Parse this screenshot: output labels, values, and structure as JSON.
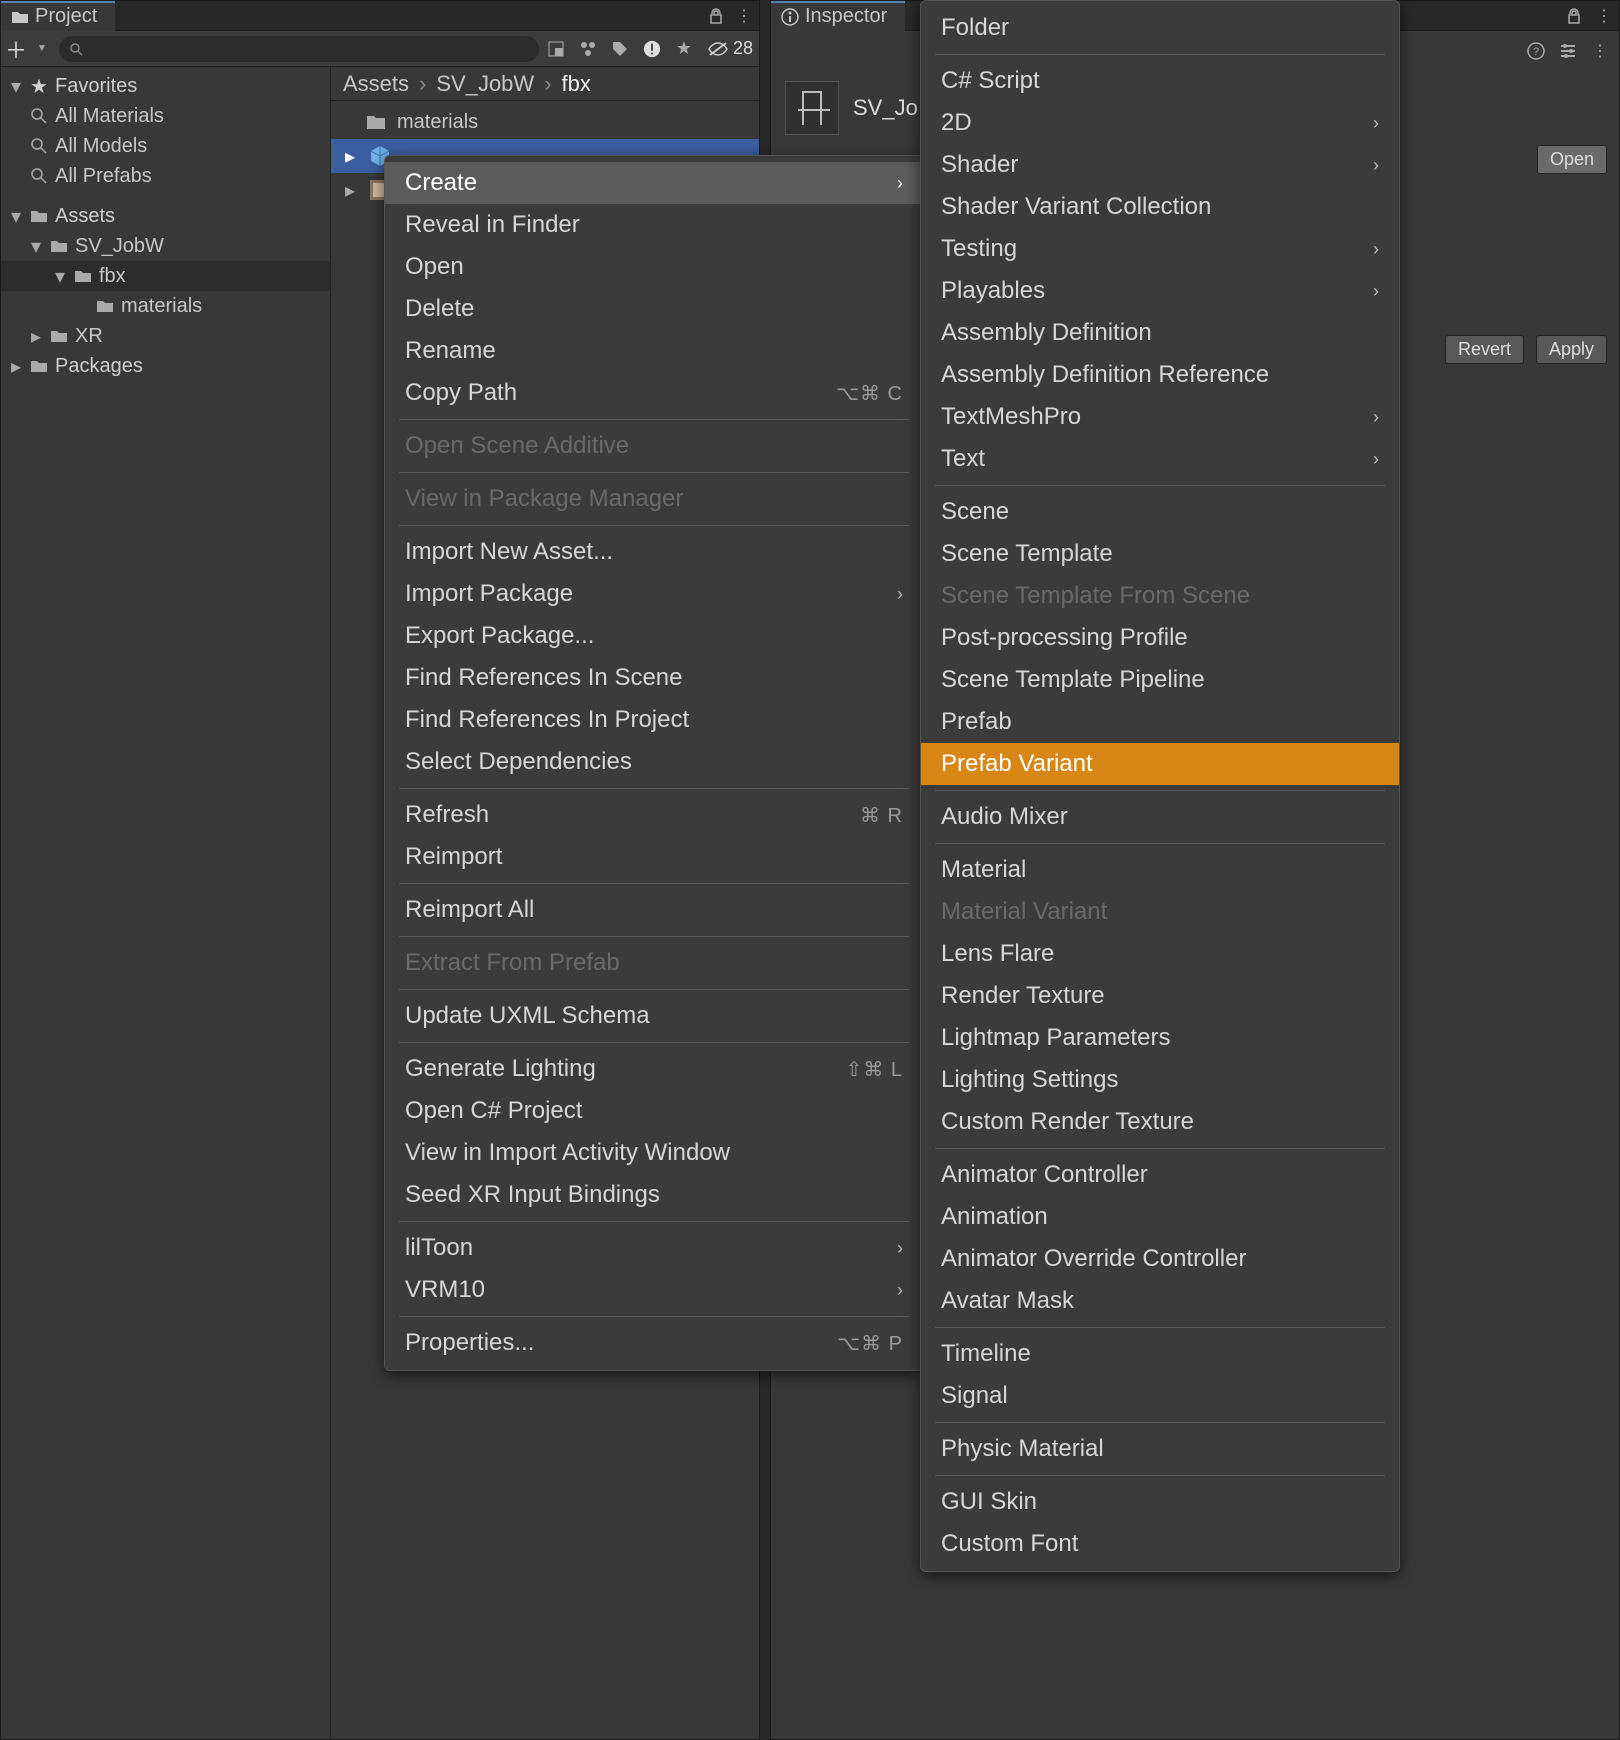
{
  "project": {
    "tab_label": "Project",
    "search_placeholder": "",
    "hidden_count": "28",
    "favorites": {
      "header": "Favorites",
      "items": [
        "All Materials",
        "All Models",
        "All Prefabs"
      ]
    },
    "assets": {
      "header": "Assets",
      "items": [
        {
          "label": "SV_JobW",
          "children": [
            {
              "label": "fbx",
              "children": [
                {
                  "label": "materials"
                }
              ]
            }
          ]
        },
        {
          "label": "XR"
        }
      ],
      "packages": "Packages"
    },
    "breadcrumb": [
      "Assets",
      "SV_JobW",
      "fbx"
    ],
    "files": [
      {
        "label": "materials",
        "kind": "folder"
      },
      {
        "label": "",
        "kind": "prefab-selected"
      },
      {
        "label": "",
        "kind": "image"
      }
    ]
  },
  "inspector": {
    "tab_label": "Inspector",
    "title": "SV_Jo",
    "open_button": "Open",
    "revert_button": "Revert",
    "apply_button": "Apply"
  },
  "context_menu": [
    {
      "label": "Create",
      "submenu": true,
      "highlight": true
    },
    {
      "label": "Reveal in Finder"
    },
    {
      "label": "Open"
    },
    {
      "label": "Delete"
    },
    {
      "label": "Rename"
    },
    {
      "label": "Copy Path",
      "shortcut": "⌥⌘ C"
    },
    {
      "sep": true
    },
    {
      "label": "Open Scene Additive",
      "disabled": true
    },
    {
      "sep": true
    },
    {
      "label": "View in Package Manager",
      "disabled": true
    },
    {
      "sep": true
    },
    {
      "label": "Import New Asset..."
    },
    {
      "label": "Import Package",
      "submenu": true
    },
    {
      "label": "Export Package..."
    },
    {
      "label": "Find References In Scene"
    },
    {
      "label": "Find References In Project"
    },
    {
      "label": "Select Dependencies"
    },
    {
      "sep": true
    },
    {
      "label": "Refresh",
      "shortcut": "⌘ R"
    },
    {
      "label": "Reimport"
    },
    {
      "sep": true
    },
    {
      "label": "Reimport All"
    },
    {
      "sep": true
    },
    {
      "label": "Extract From Prefab",
      "disabled": true
    },
    {
      "sep": true
    },
    {
      "label": "Update UXML Schema"
    },
    {
      "sep": true
    },
    {
      "label": "Generate Lighting",
      "shortcut": "⇧⌘ L"
    },
    {
      "label": "Open C# Project"
    },
    {
      "label": "View in Import Activity Window"
    },
    {
      "label": "Seed XR Input Bindings"
    },
    {
      "sep": true
    },
    {
      "label": "lilToon",
      "submenu": true
    },
    {
      "label": "VRM10",
      "submenu": true
    },
    {
      "sep": true
    },
    {
      "label": "Properties...",
      "shortcut": "⌥⌘ P"
    }
  ],
  "create_menu": [
    {
      "label": "Folder"
    },
    {
      "sep": true
    },
    {
      "label": "C# Script"
    },
    {
      "label": "2D",
      "submenu": true
    },
    {
      "label": "Shader",
      "submenu": true
    },
    {
      "label": "Shader Variant Collection"
    },
    {
      "label": "Testing",
      "submenu": true
    },
    {
      "label": "Playables",
      "submenu": true
    },
    {
      "label": "Assembly Definition"
    },
    {
      "label": "Assembly Definition Reference"
    },
    {
      "label": "TextMeshPro",
      "submenu": true
    },
    {
      "label": "Text",
      "submenu": true
    },
    {
      "sep": true
    },
    {
      "label": "Scene"
    },
    {
      "label": "Scene Template"
    },
    {
      "label": "Scene Template From Scene",
      "disabled": true
    },
    {
      "label": "Post-processing Profile"
    },
    {
      "label": "Scene Template Pipeline"
    },
    {
      "label": "Prefab"
    },
    {
      "label": "Prefab Variant",
      "selected": true
    },
    {
      "sep": true
    },
    {
      "label": "Audio Mixer"
    },
    {
      "sep": true
    },
    {
      "label": "Material"
    },
    {
      "label": "Material Variant",
      "disabled": true
    },
    {
      "label": "Lens Flare"
    },
    {
      "label": "Render Texture"
    },
    {
      "label": "Lightmap Parameters"
    },
    {
      "label": "Lighting Settings"
    },
    {
      "label": "Custom Render Texture"
    },
    {
      "sep": true
    },
    {
      "label": "Animator Controller"
    },
    {
      "label": "Animation"
    },
    {
      "label": "Animator Override Controller"
    },
    {
      "label": "Avatar Mask"
    },
    {
      "sep": true
    },
    {
      "label": "Timeline"
    },
    {
      "label": "Signal"
    },
    {
      "sep": true
    },
    {
      "label": "Physic Material"
    },
    {
      "sep": true
    },
    {
      "label": "GUI Skin"
    },
    {
      "label": "Custom Font"
    }
  ]
}
